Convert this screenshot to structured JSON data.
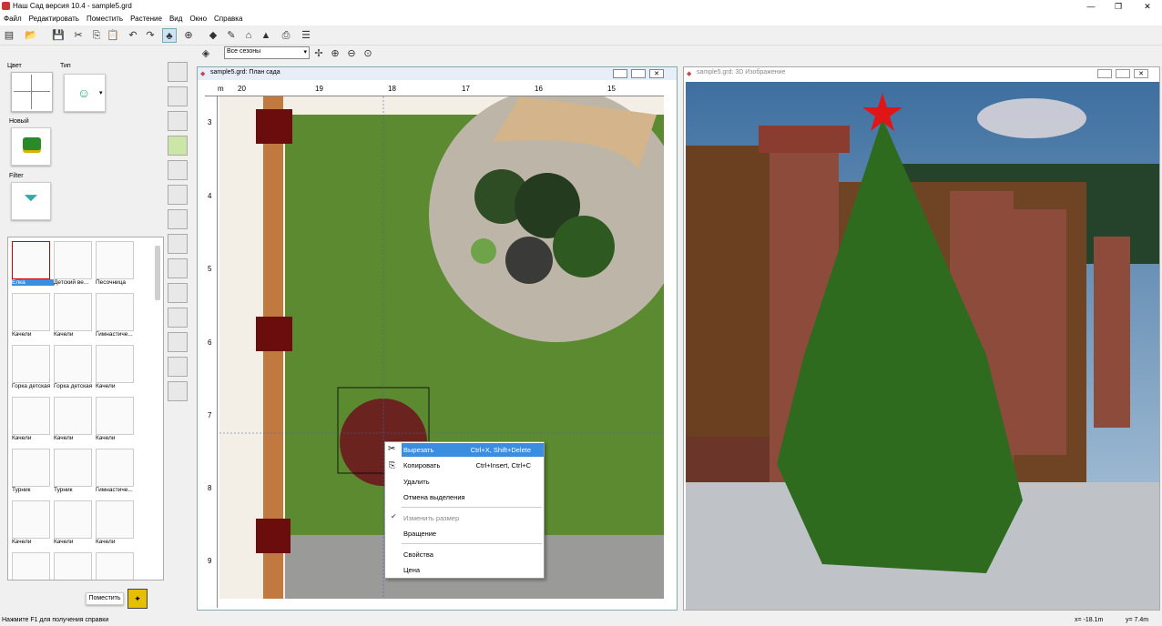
{
  "app": {
    "title": "Наш Сад версия 10.4 - sample5.grd"
  },
  "window_controls": {
    "minimize": "—",
    "maximize": "❐",
    "close": "✕"
  },
  "menu": [
    "Файл",
    "Редактировать",
    "Поместить",
    "Растение",
    "Вид",
    "Окно",
    "Справка"
  ],
  "toolbar2": {
    "season": "Все сезоны"
  },
  "left": {
    "color_label": "Цвет",
    "type_label": "Тип",
    "new_label": "Новый",
    "filter_label": "Filter",
    "place_button": "Поместить"
  },
  "library": [
    {
      "label": "Ёлка",
      "selected": true
    },
    {
      "label": "Детский ве..."
    },
    {
      "label": "Песочница"
    },
    {
      "label": "Качели"
    },
    {
      "label": "Качели"
    },
    {
      "label": "Гимнастиче..."
    },
    {
      "label": "Горка детская"
    },
    {
      "label": "Горка детская"
    },
    {
      "label": "Качели"
    },
    {
      "label": "Качели"
    },
    {
      "label": "Качели"
    },
    {
      "label": "Качели"
    },
    {
      "label": "Турник"
    },
    {
      "label": "Турник"
    },
    {
      "label": "Гимнастиче..."
    },
    {
      "label": "Качели"
    },
    {
      "label": "Качели"
    },
    {
      "label": "Качели"
    },
    {
      "label": ""
    },
    {
      "label": ""
    },
    {
      "label": ""
    }
  ],
  "plan": {
    "title": "sample5.grd: План сада",
    "ruler_top": [
      "20",
      "19",
      "18",
      "17",
      "16",
      "15"
    ],
    "ruler_left": [
      "3",
      "4",
      "5",
      "6",
      "7",
      "8",
      "9"
    ],
    "unit": "m"
  },
  "view3d": {
    "title": "sample5.grd: 3D Изображение"
  },
  "context_menu": [
    {
      "label": "Вырезать",
      "shortcut": "Ctrl+X, Shift+Delete",
      "highlight": true,
      "icon": "scissors-icon"
    },
    {
      "label": "Копировать",
      "shortcut": "Ctrl+Insert, Ctrl+C",
      "icon": "copy-icon"
    },
    {
      "label": "Удалить",
      "shortcut": ""
    },
    {
      "label": "Отмена выделения",
      "shortcut": ""
    },
    {
      "label": "Изменить размер",
      "shortcut": "",
      "checked": true,
      "disabled": true
    },
    {
      "label": "Вращение",
      "shortcut": ""
    },
    {
      "label": "Свойства",
      "shortcut": ""
    },
    {
      "label": "Цена",
      "shortcut": ""
    }
  ],
  "status": {
    "hint": "Нажмите F1 для получения справки",
    "x": "x= -18.1m",
    "y": "y= 7.4m"
  },
  "colors": {
    "accent": "#3399ff",
    "menu_highlight": "#3b8de0",
    "grass": "#5c8a2e",
    "brick": "#8b3a2a",
    "tree": "#2e6b1f"
  }
}
